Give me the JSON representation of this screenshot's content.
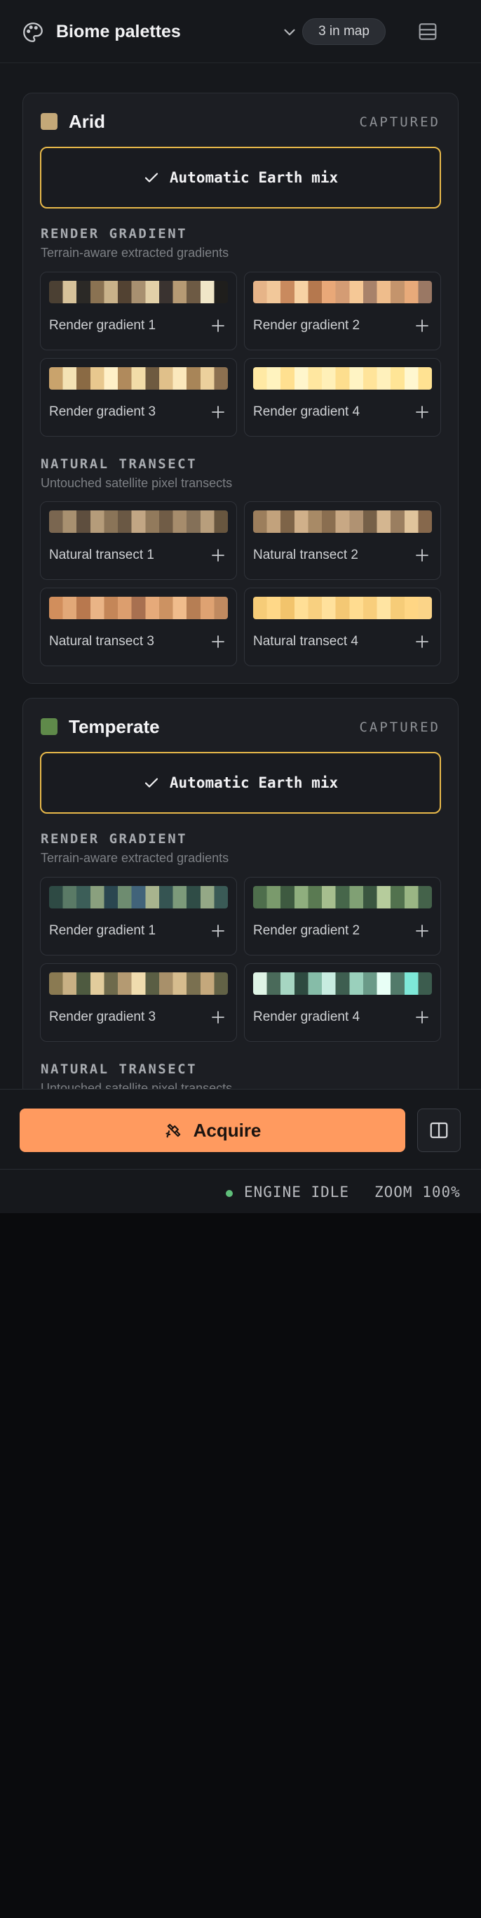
{
  "header": {
    "title": "Biome palettes",
    "badge": "3 in map",
    "icons": {
      "app": "palette-icon",
      "dropdown": "chevron-down-icon",
      "menu": "list-icon"
    }
  },
  "colors": {
    "accent": "#ff9a5f",
    "mix_border": "#e8b94a",
    "status_ok": "#5fbf7a"
  },
  "biomes": [
    {
      "name": "Arid",
      "swatch": "#c4a878",
      "status": "CAPTURED",
      "mix_label": "Automatic Earth mix",
      "sections": [
        {
          "title": "RENDER GRADIENT",
          "subtitle": "Terrain-aware extracted gradients",
          "items": [
            {
              "label": "Render gradient 1",
              "stops": [
                "#4b4033",
                "#d7c29a",
                "#2b2926",
                "#8a7252",
                "#c9b28a",
                "#524232",
                "#a89070",
                "#e2d0a8",
                "#3a3330",
                "#b69a74",
                "#6d5a44",
                "#f0e6c8",
                "#1f1e1c"
              ]
            },
            {
              "label": "Render gradient 2",
              "stops": [
                "#e6b488",
                "#f2c89a",
                "#c98a5e",
                "#f7d2a4",
                "#b5784e",
                "#e9a878",
                "#d49c74",
                "#f5c896",
                "#a8826a",
                "#efbd8c",
                "#c4946c",
                "#e8aa7a",
                "#9a7864"
              ]
            },
            {
              "label": "Render gradient 3",
              "stops": [
                "#c9a36c",
                "#f4e2b4",
                "#8a6a44",
                "#e8c88e",
                "#fff0c8",
                "#b08a5c",
                "#f2dca8",
                "#6e5a40",
                "#e0c08a",
                "#fbe8bc",
                "#a88558",
                "#ecd09c",
                "#8c7050"
              ]
            },
            {
              "label": "Render gradient 4",
              "stops": [
                "#ffe9a4",
                "#fff3bf",
                "#ffe090",
                "#fff6cc",
                "#ffe7a0",
                "#fff0b8",
                "#fdde8e",
                "#fff4c4",
                "#ffe49a",
                "#fff1bc",
                "#ffe596",
                "#fff7d0",
                "#ffe292"
              ]
            }
          ]
        },
        {
          "title": "NATURAL TRANSECT",
          "subtitle": "Untouched satellite pixel transects",
          "items": [
            {
              "label": "Natural transect 1",
              "stops": [
                "#7a6650",
                "#a89070",
                "#5e4e3e",
                "#b59c7a",
                "#8a7458",
                "#6a5844",
                "#c2a684",
                "#927a5c",
                "#705c46",
                "#a68c6c",
                "#847058",
                "#b89e7c",
                "#68563f"
              ]
            },
            {
              "label": "Natural transect 2",
              "stops": [
                "#9c7e5c",
                "#c2a27c",
                "#7e6448",
                "#d0b08a",
                "#a88a66",
                "#8a6e50",
                "#c8a884",
                "#b09272",
                "#766048",
                "#d4b690",
                "#9a7e60",
                "#e0c49c",
                "#86684c"
              ]
            },
            {
              "label": "Natural transect 3",
              "stops": [
                "#d18e5c",
                "#e2a878",
                "#b8784e",
                "#eab486",
                "#c48658",
                "#dc9e6e",
                "#a87050",
                "#e6aa7a",
                "#cc9262",
                "#f0bc8c",
                "#b67e54",
                "#dea272",
                "#c08a60"
              ]
            },
            {
              "label": "Natural transect 4",
              "stops": [
                "#f6cc78",
                "#ffd888",
                "#f2c46c",
                "#ffdf96",
                "#f8d080",
                "#ffe19c",
                "#f4c874",
                "#ffdc90",
                "#f8ce7c",
                "#ffe4a2",
                "#f6cc78",
                "#ffd684",
                "#fbd488"
              ]
            }
          ]
        }
      ]
    },
    {
      "name": "Temperate",
      "swatch": "#5f8a4a",
      "status": "CAPTURED",
      "mix_label": "Automatic Earth mix",
      "sections": [
        {
          "title": "RENDER GRADIENT",
          "subtitle": "Terrain-aware extracted gradients",
          "items": [
            {
              "label": "Render gradient 1",
              "stops": [
                "#2e4a44",
                "#5a7a66",
                "#3c5e58",
                "#8aa07e",
                "#2a4650",
                "#6e8c70",
                "#41637a",
                "#a8b48e",
                "#355452",
                "#7c9a7a",
                "#2f4c46",
                "#94a886",
                "#3a5a56"
              ]
            },
            {
              "label": "Render gradient 2",
              "stops": [
                "#4e6e4c",
                "#7a9a6c",
                "#3e5a40",
                "#8fae7e",
                "#5a7a52",
                "#a6be8e",
                "#46664a",
                "#80a074",
                "#3a5640",
                "#b6cc9c",
                "#52724e",
                "#9ab684",
                "#44624a"
              ]
            },
            {
              "label": "Render gradient 3",
              "stops": [
                "#8a7a52",
                "#c8b084",
                "#4e5a40",
                "#e2cc9c",
                "#6e6a4c",
                "#b49a72",
                "#f0dcae",
                "#5a5e44",
                "#a8906a",
                "#d6bc8e",
                "#7a7050",
                "#c4a87c",
                "#626246"
              ]
            },
            {
              "label": "Render gradient 4",
              "stops": [
                "#dff4e6",
                "#4a6a5a",
                "#a6d6c2",
                "#2e4a40",
                "#86bca8",
                "#c8ece0",
                "#3e5e50",
                "#9ad0bc",
                "#6a9a88",
                "#e8fff6",
                "#527a6a",
                "#7ee8d8",
                "#3c5c4e"
              ]
            }
          ]
        },
        {
          "title": "NATURAL TRANSECT",
          "subtitle": "Untouched satellite pixel transects"
        }
      ]
    }
  ],
  "footer": {
    "acquire_label": "Acquire",
    "acquire_icon": "satellite-icon",
    "panel_icon": "split-panel-icon"
  },
  "statusbar": {
    "engine": "ENGINE IDLE",
    "zoom": "ZOOM 100%"
  }
}
